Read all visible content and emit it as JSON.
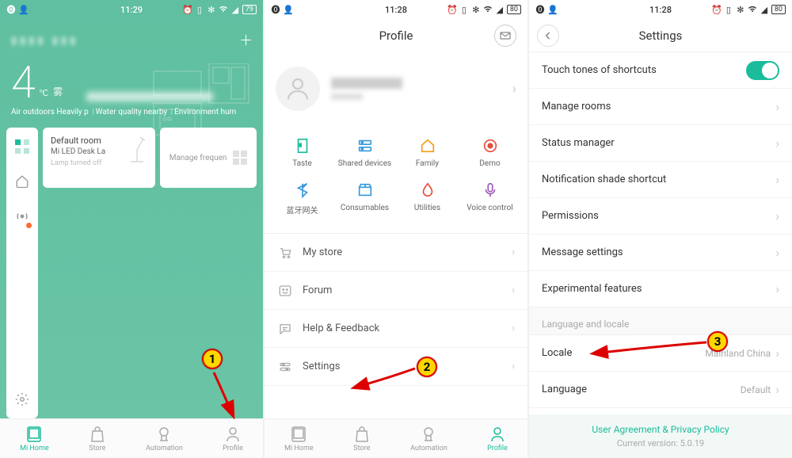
{
  "status_bar": {
    "time": "11:29",
    "time2": "11:28",
    "time3": "11:28",
    "battery1": "79",
    "battery2": "80",
    "battery3": "80"
  },
  "screen1": {
    "plus": "+",
    "temp_value": "4",
    "temp_unit": "℃",
    "temp_cn": "雾",
    "info1": "Air outdoors Heavily p",
    "info2": "Water quality nearby",
    "info3": "Environment hum",
    "card1_title": "Default room",
    "card1_sub": "Mi LED Desk La",
    "card1_stat": "Lamp turned off",
    "card2_label": "Manage frequen"
  },
  "nav": {
    "items": [
      {
        "label": "Mi Home"
      },
      {
        "label": "Store"
      },
      {
        "label": "Automation"
      },
      {
        "label": "Profile"
      }
    ]
  },
  "screen2": {
    "title": "Profile",
    "grid": [
      {
        "label": "Taste",
        "color": "#1abc9c"
      },
      {
        "label": "Shared devices",
        "color": "#3498db"
      },
      {
        "label": "Family",
        "color": "#f39c12"
      },
      {
        "label": "Demo",
        "color": "#e74c3c"
      },
      {
        "label": "蓝牙网关",
        "color": "#3498db"
      },
      {
        "label": "Consumables",
        "color": "#3498db"
      },
      {
        "label": "Utilities",
        "color": "#e74c3c"
      },
      {
        "label": "Voice control",
        "color": "#9b59b6"
      }
    ],
    "rows": [
      {
        "label": "My store"
      },
      {
        "label": "Forum"
      },
      {
        "label": "Help & Feedback"
      },
      {
        "label": "Settings"
      }
    ]
  },
  "screen3": {
    "title": "Settings",
    "row_toggle": "Touch tones of shortcuts",
    "rows1": [
      "Manage rooms",
      "Status manager",
      "Notification shade shortcut",
      "Permissions",
      "Message settings",
      "Experimental features"
    ],
    "section": "Language and locale",
    "locale_label": "Locale",
    "locale_value": "Mainland China",
    "language_label": "Language",
    "language_value": "Default",
    "footer_link": "User Agreement & Privacy Policy",
    "footer_version": "Current version: 5.0.19"
  },
  "annotations": {
    "n1": "1",
    "n2": "2",
    "n3": "3"
  }
}
